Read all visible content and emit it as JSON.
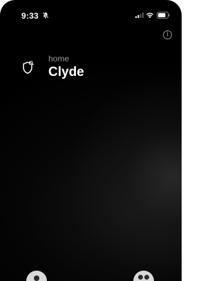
{
  "status_bar": {
    "time": "9:33",
    "icons": [
      "bell-off-icon",
      "signal-icon",
      "wifi-icon",
      "battery-icon"
    ]
  },
  "header": {
    "info_icon": "info-icon",
    "info_glyph": "i"
  },
  "accessory": {
    "icon": "security-shield-icon",
    "room": "home",
    "name": "Clyde"
  },
  "bottom_controls": {
    "left_icon": "person-icon",
    "right_icon": "settings-icon"
  },
  "colors": {
    "background": "#000000",
    "primary_text": "#ffffff",
    "secondary_text": "#9a9a9a"
  }
}
